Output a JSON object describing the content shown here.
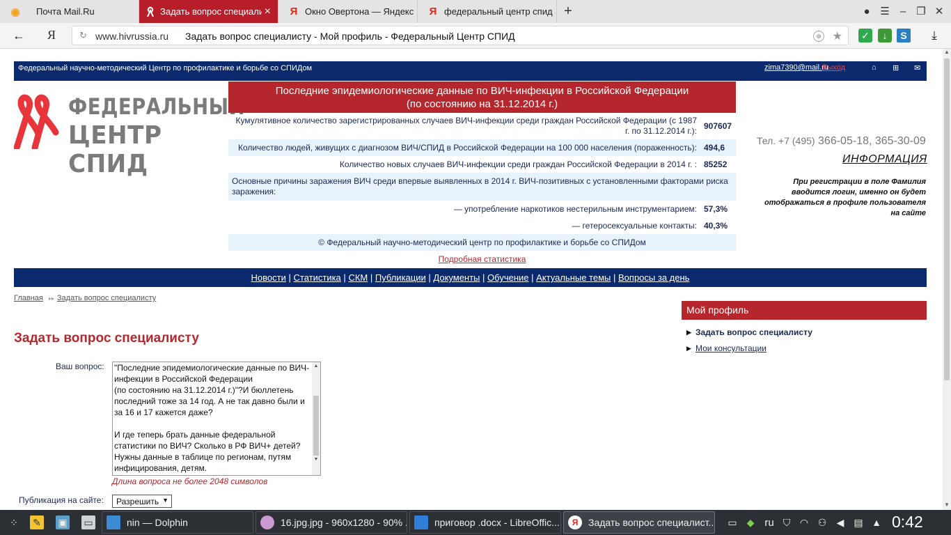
{
  "browser": {
    "tabs": [
      {
        "label": "Почта Mail.Ru",
        "icon": "mail-ru-icon"
      },
      {
        "label": "Задать вопрос специалистам",
        "icon": "aids-ribbon-icon",
        "active": true
      },
      {
        "label": "Окно Овертона — Яндекс",
        "icon": "yandex-icon"
      },
      {
        "label": "федеральный центр спид",
        "icon": "yandex-icon"
      }
    ],
    "new_tab": "+",
    "close_mark": "×",
    "yandex_logo": "Я",
    "back": "←",
    "url_domain": "www.hivrussia.ru",
    "url_title": "Задать вопрос специалисту - Мой профиль - Федеральный Центр СПИД"
  },
  "site": {
    "tagline": "Федеральный научно-методический Центр по профилактике и борьбе со СПИДом",
    "user_email": "zima7390@mail.ru",
    "logout": "Выход",
    "logo_line1": "ФЕДЕРАЛЬНЫЙ",
    "logo_line2": "ЦЕНТР СПИД"
  },
  "stats": {
    "header_line1": "Последние эпидемиологические данные по ВИЧ-инфекции в Российской Федерации",
    "header_line2": "(по состоянию на 31.12.2014 г.)",
    "rows": [
      {
        "label": "Кумулятивное количество зарегистрированных случаев ВИЧ-инфекции среди граждан Российской Федерации (с 1987 г. по 31.12.2014 г.):",
        "value": "907607"
      },
      {
        "label": "Количество людей, живущих с диагнозом ВИЧ/СПИД в Российской Федерации на 100 000 населения (пораженность):",
        "value": "494,6"
      },
      {
        "label": "Количество новых случаев ВИЧ-инфекции среди граждан Российской Федерации в 2014 г. :",
        "value": "85252"
      }
    ],
    "causes_label": "Основные причины заражения ВИЧ среди впервые выявленных в 2014 г. ВИЧ-позитивных с установленными факторами риска заражения:",
    "cause_rows": [
      {
        "label": "— употребление наркотиков нестерильным инструментарием:",
        "value": "57,3%"
      },
      {
        "label": "— гетеросексуальные контакты:",
        "value": "40,3%"
      }
    ],
    "copyright": "© Федеральный научно-методический центр по профилактике и борьбе со СПИДом",
    "more_link": "Подробная статистика"
  },
  "contact": {
    "phone_prefix": "Тел. +7 (495)",
    "phone_numbers": "366-05-18, 365-30-09",
    "info_heading": "ИНФОРМАЦИЯ",
    "info_text": "При регистрации в поле Фамилия вводится логин, именно он будет отображаться в профиле пользователя на сайте"
  },
  "menu": [
    "Новости",
    "Статистика",
    "СКМ",
    "Публикации",
    "Документы",
    "Обучение",
    "Актуальные темы",
    "Вопросы за день"
  ],
  "menu_sep": "|",
  "breadcrumb": {
    "home": "Главная",
    "current": "Задать вопрос специалисту"
  },
  "profile": {
    "heading": "Мой профиль",
    "items": [
      "Задать вопрос специалисту",
      "Мои консультации"
    ]
  },
  "form": {
    "title": "Задать вопрос специалисту",
    "question_label": "Ваш вопрос:",
    "question_value": "\"Последние эпидемиологические данные по ВИЧ-инфекции в Российской Федерации\n(по состоянию на 31.12.2014 г.)\"?И бюллетень последний тоже за 14 год. А не так давно были и за 16 и 17 кажется даже?\n\nИ где теперь брать данные федеральной статистики по ВИЧ? Сколько в РФ ВИЧ+ детей? Нужны данные в таблице по регионам, путям инфицирования, детям.",
    "hint": "Длина вопроса не более 2048 символов",
    "publish_label": "Публикация на сайте:",
    "publish_value": "Разрешить"
  },
  "taskbar": {
    "tasks": [
      {
        "label": "nin — Dolphin",
        "icon": "folder-icon"
      },
      {
        "label": "16.jpg.jpg - 960x1280 - 90% ...",
        "icon": "image-viewer-icon"
      },
      {
        "label": "приговор .docx - LibreOffic...",
        "icon": "document-icon"
      },
      {
        "label": "Задать вопрос специалист...",
        "icon": "yandex-browser-icon",
        "active": true
      }
    ],
    "language": "ru",
    "clock": "0:42"
  },
  "colors": {
    "brand_red": "#b5272d",
    "brand_navy": "#0b2a6e",
    "active_tab": "#b81e2a"
  }
}
